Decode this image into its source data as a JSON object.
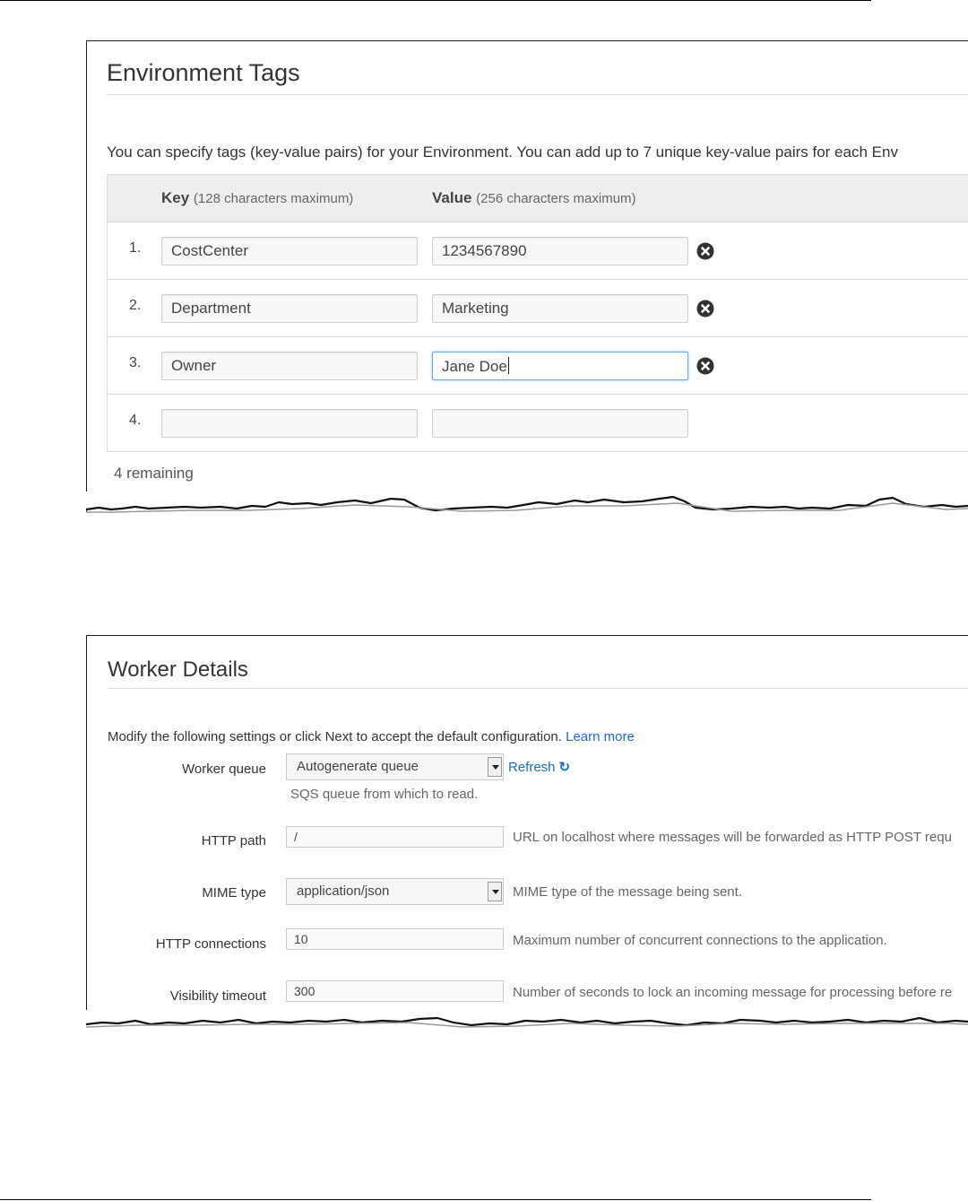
{
  "environment_tags": {
    "title": "Environment Tags",
    "description": "You can specify tags (key-value pairs) for your Environment. You can add up to 7 unique key-value pairs for each Env",
    "table": {
      "key_header": "Key",
      "key_hint": "(128 characters maximum)",
      "value_header": "Value",
      "value_hint": "(256 characters maximum)",
      "rows": [
        {
          "num": "1.",
          "key": "CostCenter",
          "value": "1234567890",
          "removable": true
        },
        {
          "num": "2.",
          "key": "Department",
          "value": "Marketing",
          "removable": true
        },
        {
          "num": "3.",
          "key": "Owner",
          "value": "Jane Doe",
          "removable": true,
          "focused": true
        },
        {
          "num": "4.",
          "key": "",
          "value": "",
          "removable": false
        }
      ]
    },
    "remaining": "4 remaining",
    "remove_icon": "remove-circle-icon"
  },
  "worker_details": {
    "title": "Worker Details",
    "intro_text": "Modify the following settings or click Next to accept the default configuration.",
    "learn_more": "Learn more",
    "fields": {
      "worker_queue": {
        "label": "Worker queue",
        "value": "Autogenerate queue",
        "help": "SQS queue from which to read.",
        "refresh": "Refresh",
        "refresh_icon": "refresh-icon"
      },
      "http_path": {
        "label": "HTTP path",
        "value": "/",
        "help": "URL on localhost where messages will be forwarded as HTTP POST requ"
      },
      "mime_type": {
        "label": "MIME type",
        "value": "application/json",
        "help": "MIME type of the message being sent."
      },
      "http_connections": {
        "label": "HTTP connections",
        "value": "10",
        "help": "Maximum number of concurrent connections to the application."
      },
      "visibility_timeout": {
        "label": "Visibility timeout",
        "value": "300",
        "help": "Number of seconds to lock an incoming message for processing before re"
      }
    }
  },
  "colors": {
    "link": "#1a6fc4",
    "focus_border": "#6aa8e6",
    "table_header_bg": "#eeeeee"
  }
}
